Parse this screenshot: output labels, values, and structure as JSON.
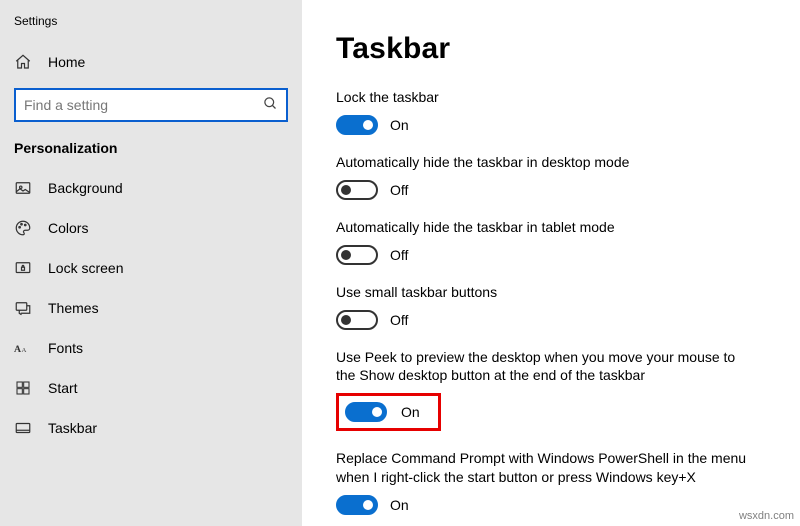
{
  "window": {
    "title": "Settings"
  },
  "sidebar": {
    "home": "Home",
    "section": "Personalization",
    "items": [
      {
        "label": "Background"
      },
      {
        "label": "Colors"
      },
      {
        "label": "Lock screen"
      },
      {
        "label": "Themes"
      },
      {
        "label": "Fonts"
      },
      {
        "label": "Start"
      },
      {
        "label": "Taskbar"
      }
    ]
  },
  "search": {
    "placeholder": "Find a setting"
  },
  "page": {
    "title": "Taskbar"
  },
  "settings": [
    {
      "label": "Lock the taskbar",
      "state": "On",
      "on": true
    },
    {
      "label": "Automatically hide the taskbar in desktop mode",
      "state": "Off",
      "on": false
    },
    {
      "label": "Automatically hide the taskbar in tablet mode",
      "state": "Off",
      "on": false
    },
    {
      "label": "Use small taskbar buttons",
      "state": "Off",
      "on": false
    },
    {
      "label": "Use Peek to preview the desktop when you move your mouse to the Show desktop button at the end of the taskbar",
      "state": "On",
      "on": true
    },
    {
      "label": "Replace Command Prompt with Windows PowerShell in the menu when I right-click the start button or press Windows key+X",
      "state": "On",
      "on": true
    }
  ],
  "watermark": "wsxdn.com"
}
